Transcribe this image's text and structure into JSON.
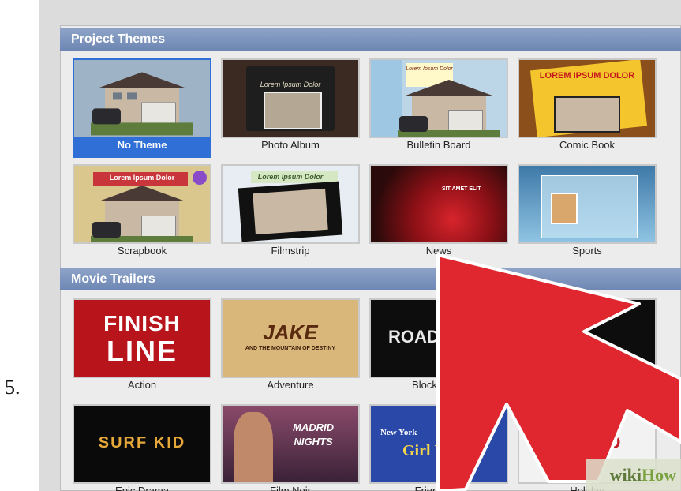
{
  "step_number": "5.",
  "sections": [
    {
      "title": "Project Themes"
    },
    {
      "title": "Movie Trailers"
    }
  ],
  "themes": [
    {
      "label": "No Theme",
      "selected": true,
      "overlay": ""
    },
    {
      "label": "Photo Album",
      "selected": false,
      "overlay": "Lorem Ipsum Dolor"
    },
    {
      "label": "Bulletin Board",
      "selected": false,
      "overlay": "Lorem Ipsum Dolor"
    },
    {
      "label": "Comic Book",
      "selected": false,
      "overlay": "LOREM IPSUM DOLOR"
    },
    {
      "label": "Scrapbook",
      "selected": false,
      "overlay": "Lorem Ipsum Dolor"
    },
    {
      "label": "Filmstrip",
      "selected": false,
      "overlay": "Lorem Ipsum Dolor"
    },
    {
      "label": "News",
      "selected": false,
      "overlay": "SIT AMET ELIT"
    },
    {
      "label": "Sports",
      "selected": false,
      "overlay": ""
    }
  ],
  "trailers": [
    {
      "label": "Action",
      "title_line1": "FINISH",
      "title_line2": "LINE"
    },
    {
      "label": "Adventure",
      "title_line1": "JAKE",
      "title_line2": "AND THE MOUNTAIN OF DESTINY"
    },
    {
      "label": "Blockbuster",
      "title_line1": "ROAD TR",
      "title_line2": ""
    },
    {
      "label": "",
      "title_line1": "",
      "title_line2": ""
    },
    {
      "label": "Epic Drama",
      "title_line1": "SURF KID",
      "title_line2": ""
    },
    {
      "label": "Film Noir",
      "title_line1": "MADRID",
      "title_line2": "NIGHTS"
    },
    {
      "label": "Friendship",
      "title_line1": "New York",
      "title_line2": "Girl Posse"
    },
    {
      "label": "Holiday",
      "title_line1": "HOLID",
      "title_line2": ""
    }
  ],
  "watermark": {
    "wiki": "wiki",
    "how": "How"
  },
  "colors": {
    "section_header": "#7690bd",
    "selected": "#2f6fd6",
    "arrow": "#e0262e"
  }
}
